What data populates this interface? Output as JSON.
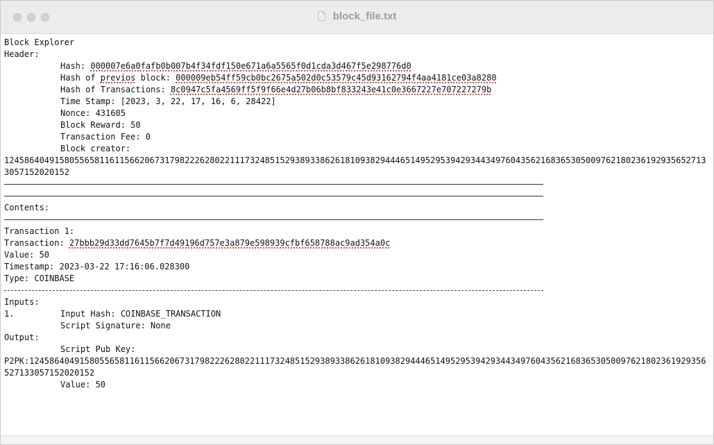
{
  "window": {
    "title": "block_file.txt",
    "icons": {
      "close": "close-icon",
      "minimize": "minimize-icon",
      "zoom": "zoom-icon",
      "document": "document-icon"
    },
    "colors": {
      "titlebar": "#ececec",
      "title_text": "#9c9c9c",
      "spell_underline": "#e34b4b"
    }
  },
  "document": {
    "heading": "Block Explorer",
    "header_label": "Header:",
    "header": {
      "hash_label": "Hash: ",
      "hash_value": "000007e6a0fafb0b007b4f34fdf150e671a6a5565f0d1cda3d467f5e298776d0",
      "prev_label_prefix": "Hash of ",
      "prev_label_misspelled": "previos",
      "prev_label_suffix": " block: ",
      "prev_value": "000009eb54ff59cb0bc2675a502d0c53579c45d93162794f4aa4181ce03a8280",
      "tx_hash_label": "Hash of Transactions: ",
      "tx_hash_value": "8c0947c5fa4569ff5f9f66e4d27b06b8bf833243e41c0e3667227e707227279b",
      "timestamp_text": "Time Stamp: [2023, 3, 22, 17, 16, 6, 28422]",
      "nonce_text": "Nonce: 431605",
      "block_reward_text": "Block Reward: 50",
      "transaction_fee_text": "Transaction Fee: 0",
      "block_creator_label": "Block creator:",
      "block_creator_value": "124586404915805565811611566206731798222628022111732485152938933862618109382944465149529539429344349760435621683653050097621802361929356527133057152020152"
    },
    "contents_label": "Contents:",
    "transaction": {
      "title": "Transaction 1:",
      "hash_label": "Transaction: ",
      "hash_value": "27bbb29d33dd7645b7f7d49196d757e3a879e598939cfbf658788ac9ad354a0c",
      "value_text": "Value: 50",
      "timestamp_text": "Timestamp: 2023-03-22 17:16:06.028300",
      "type_text": "Type: COINBASE"
    },
    "inputs_label": "Inputs:",
    "input": {
      "index": "1.",
      "hash_text": "Input Hash: COINBASE_TRANSACTION",
      "signature_text": "Script Signature: None"
    },
    "output_label": "Output:",
    "output": {
      "script_pub_key_label": "Script Pub Key:",
      "script_pub_key_value": "P2PK:124586404915805565811611566206731798222628022111732485152938933862618109382944465149529539429344349760435621683653050097621802361929356527133057152020152",
      "value_text": "Value: 50"
    }
  }
}
